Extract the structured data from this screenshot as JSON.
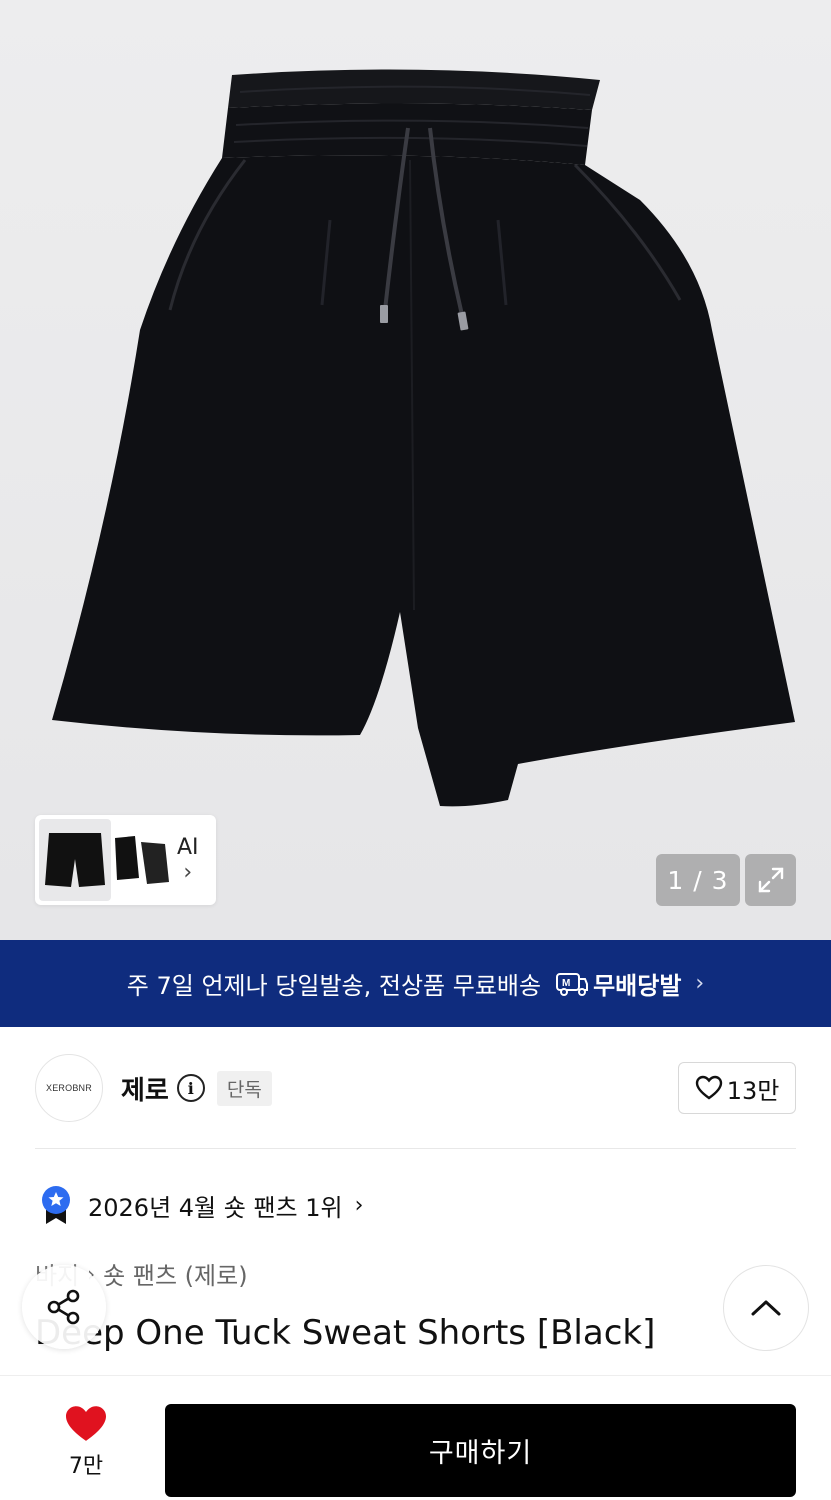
{
  "gallery": {
    "pager_text": "1 / 3",
    "ai_label": "AI",
    "current_index": 1,
    "total": 3
  },
  "banner": {
    "text": "주 7일 언제나 당일발송, 전상품 무료배송",
    "brand": "무배당발",
    "icon": "truck-m-icon",
    "bg_color": "#0f2c7e"
  },
  "brand": {
    "logo_text": "XEROBNR",
    "name": "제로",
    "exclusive_badge": "단독",
    "like_count": "13만"
  },
  "ranking": {
    "text": "2026년 4월 숏 팬츠 1위"
  },
  "breadcrumb": {
    "category": "바지",
    "subcategory": "숏 팬츠 (제로)"
  },
  "product": {
    "title": "Deep One Tuck Sweat Shorts [Black]"
  },
  "bottom": {
    "wish_count": "7만",
    "buy_label": "구매하기",
    "heart_color": "#e0121f"
  }
}
